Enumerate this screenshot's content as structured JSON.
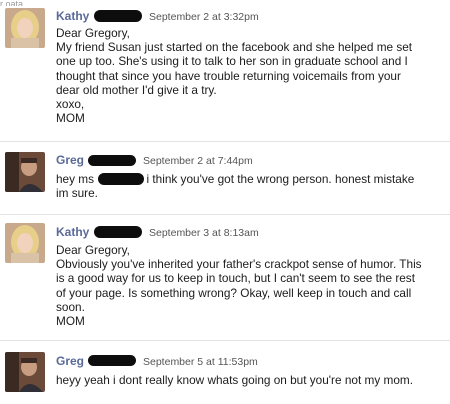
{
  "top_stub": "r oata",
  "messages": [
    {
      "sender": "Kathy",
      "timestamp": "September 2 at 3:32pm",
      "lines": [
        "Dear Gregory,",
        "My friend Susan just started on the facebook and she helped me set",
        "one up too. She's using it to talk to her son in graduate school and I",
        "thought that since you have trouble returning voicemails from your",
        "dear old mother I'd give it a try.",
        "xoxo,",
        "MOM"
      ]
    },
    {
      "sender": "Greg",
      "timestamp": "September 2 at 7:44pm",
      "lines": [
        "hey ms                i think you've got the wrong person. honest mistake",
        "im sure."
      ]
    },
    {
      "sender": "Kathy",
      "timestamp": "September 3 at 8:13am",
      "lines": [
        "Dear Gregory,",
        "Obviously you've inherited your father's crackpot sense of humor. This",
        "is a good way for us to keep in touch, but I can't seem to see the rest",
        "of your page. Is something wrong? Okay, well keep in touch and call",
        "soon.",
        "MOM"
      ]
    },
    {
      "sender": "Greg",
      "timestamp": "September 5 at 11:53pm",
      "lines": [
        "heyy yeah i dont really know whats going on but you're not my mom."
      ]
    }
  ]
}
